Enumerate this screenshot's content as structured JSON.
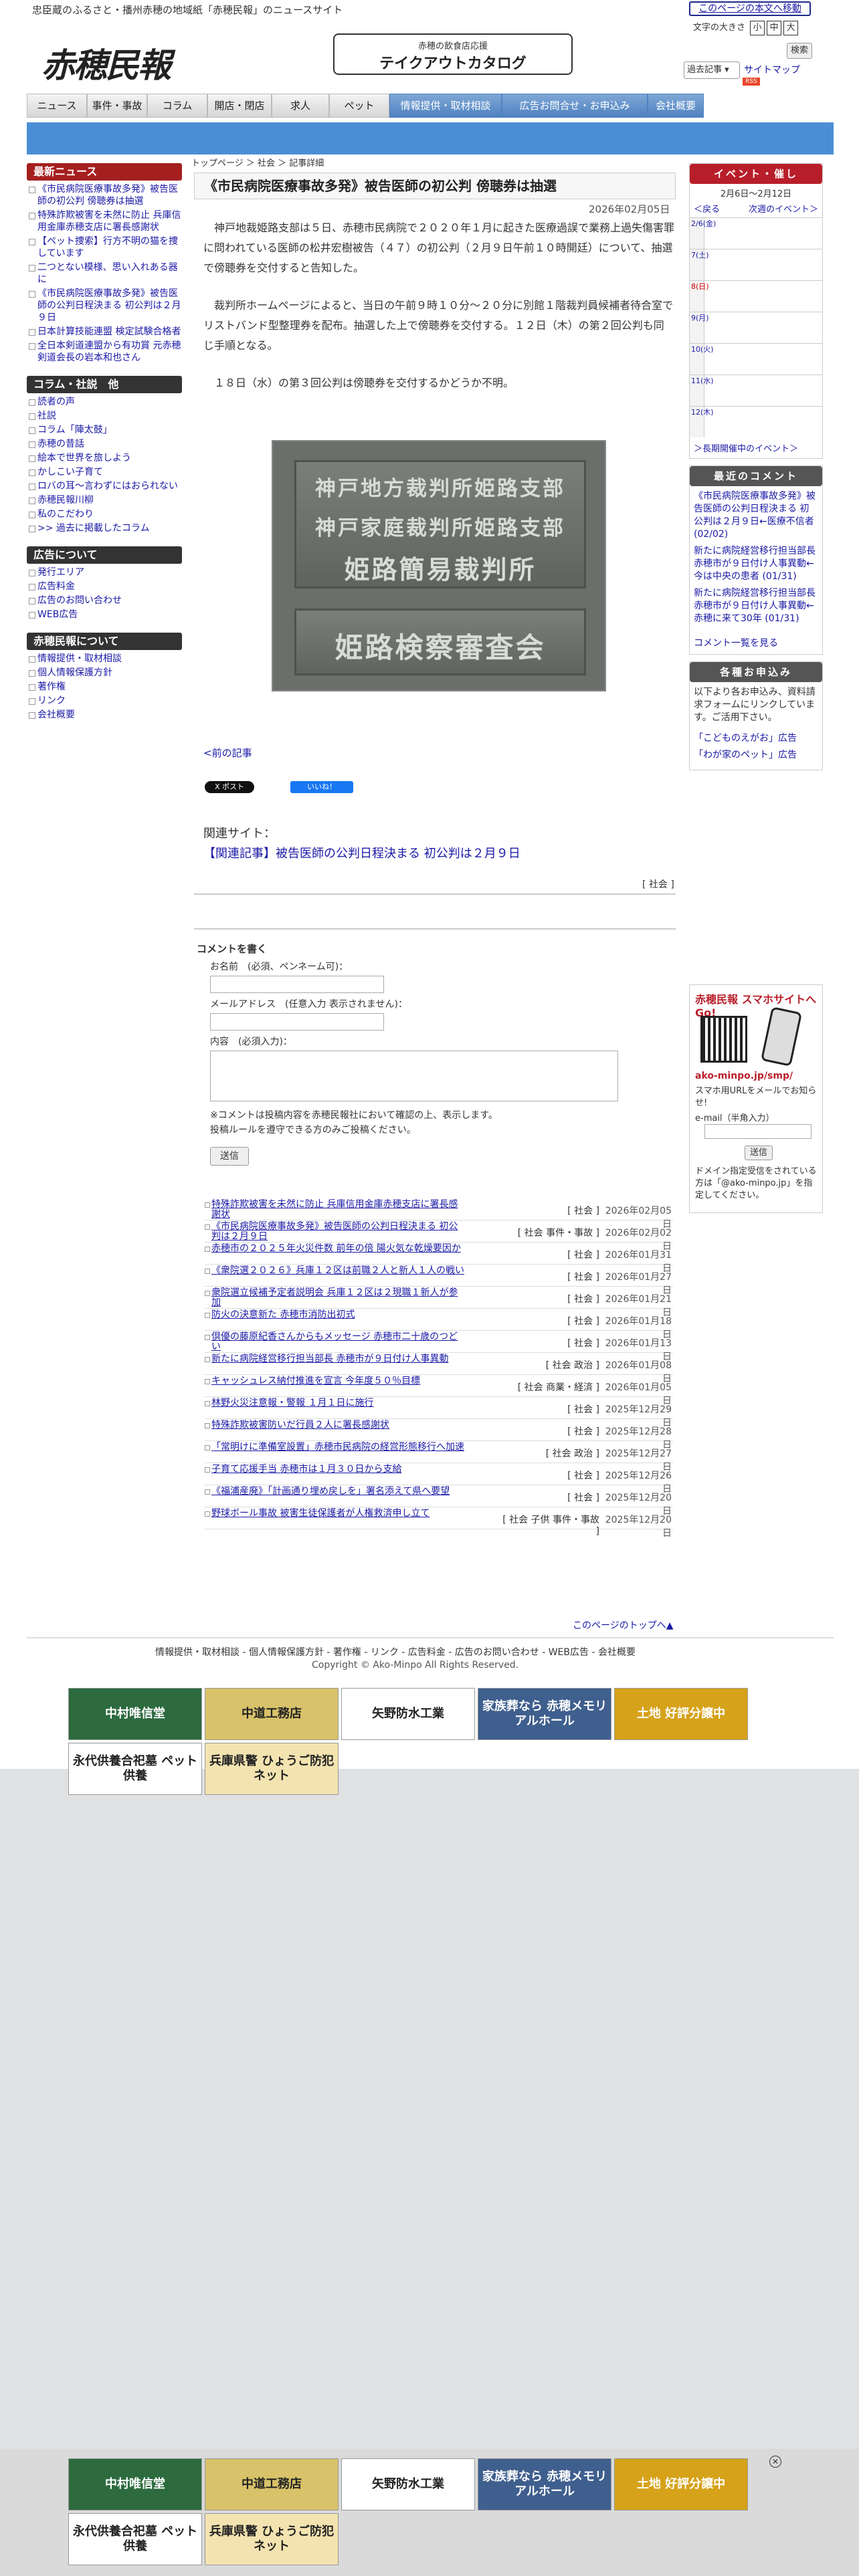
{
  "header": {
    "tagline": "忠臣蔵のふるさと・播州赤穂の地域紙「赤穂民報」のニュースサイト",
    "skip_link": "このページの本文へ移動",
    "font_size_label": "文字の大きさ",
    "font_small": "小",
    "font_medium": "中",
    "font_large": "大",
    "logo": "赤穂民報",
    "takeout_sub": "赤穂の飲食店応援",
    "takeout_main": "テイクアウトカタログ",
    "search_button": "検索",
    "past_select": "過去記事",
    "sitemap": "サイトマップ",
    "rss": "RSS"
  },
  "nav": [
    {
      "label": "ニュース",
      "style": "grey"
    },
    {
      "label": "事件・事故",
      "style": "grey"
    },
    {
      "label": "コラム",
      "style": "grey"
    },
    {
      "label": "開店・閉店",
      "style": "grey"
    },
    {
      "label": "求人",
      "style": "grey"
    },
    {
      "label": "ペット",
      "style": "grey"
    },
    {
      "label": "情報提供・取材相談",
      "style": "blue"
    },
    {
      "label": "広告お問合せ・お申込み",
      "style": "blue"
    },
    {
      "label": "会社概要",
      "style": "blue"
    }
  ],
  "left": {
    "latest_title": "最新ニュース",
    "latest": [
      "《市民病院医療事故多発》被告医師の初公判 傍聴券は抽選",
      "特殊詐欺被害を未然に防止 兵庫信用金庫赤穂支店に署長感謝状",
      "【ペット捜索】行方不明の猫を捜しています",
      "二つとない模様、思い入れある器に",
      "《市民病院医療事故多発》被告医師の公判日程決まる 初公判は２月９日",
      "日本計算技能連盟 検定試験合格者",
      "全日本剣道連盟から有功賞 元赤穂剣道会長の岩本和也さん"
    ],
    "column_title": "コラム・社説　他",
    "column": [
      "読者の声",
      "社説",
      "コラム「陣太鼓」",
      "赤穂の昔話",
      "絵本で世界を旅しよう",
      "かしこい子育て",
      "ロバの耳〜言わずにはおられない",
      "赤穂民報川柳",
      "私のこだわり",
      ">> 過去に掲載したコラム"
    ],
    "ad_title": "広告について",
    "ad": [
      "発行エリア",
      "広告料金",
      "広告のお問い合わせ",
      "WEB広告"
    ],
    "about_title": "赤穂民報について",
    "about": [
      "情報提供・取材相談",
      "個人情報保護方針",
      "著作権",
      "リンク",
      "会社概要"
    ]
  },
  "article": {
    "breadcrumb": "トップページ ＞ 社会 ＞ 記事詳細",
    "title": "《市民病院医療事故多発》被告医師の初公判 傍聴券は抽選",
    "date": "2026年02月05日",
    "p1": "神戸地裁姫路支部は５日、赤穂市民病院で２０２０年１月に起きた医療過誤で業務上過失傷害罪に問われている医師の松井宏樹被告（４７）の初公判（２月９日午前１０時開廷）について、抽選で傍聴券を交付すると告知した。",
    "p2": "裁判所ホームページによると、当日の午前９時１０分〜２０分に別館１階裁判員候補者待合室でリストバンド型整理券を配布。抽選した上で傍聴券を交付する。１２日（木）の第２回公判も同じ手順となる。",
    "p3": "１８日（水）の第３回公判は傍聴券を交付するかどうか不明。",
    "photo_sign1": "神戸地方裁判所姫路支部",
    "photo_sign2": "神戸家庭裁判所姫路支部",
    "photo_sign3": "姫路簡易裁判所",
    "photo_sign4": "姫路検察審査会",
    "prev": "<前の記事",
    "share_x": "X ポスト",
    "share_fb": "いいね！",
    "related_label": "関連サイト：",
    "related_link": "【関連記事】被告医師の公判日程決まる 初公判は２月９日",
    "category": "[ 社会 ]"
  },
  "comment_form": {
    "heading": "コメントを書く",
    "name_label": "お名前　(必須、ペンネーム可)：",
    "mail_label": "メールアドレス　(任意入力 表示されません)：",
    "body_label": "内容　(必須入力)：",
    "note1": "※コメントは投稿内容を赤穂民報社において確認の上、表示します。",
    "note2": "投稿ルールを遵守できる方のみご投稿ください。",
    "send": "送信"
  },
  "news_list": [
    {
      "title": "特殊詐欺被害を未然に防止 兵庫信用金庫赤穂支店に署長感謝状",
      "cat": "[ 社会 ]",
      "date": "2026年02月05日"
    },
    {
      "title": "《市民病院医療事故多発》被告医師の公判日程決まる 初公判は２月９日",
      "cat": "[ 社会 事件・事故 ]",
      "date": "2026年02月02日"
    },
    {
      "title": "赤穂市の２０２５年火災件数 前年の倍 陽火気な乾燥要因か",
      "cat": "[ 社会 ]",
      "date": "2026年01月31日"
    },
    {
      "title": "《衆院選２０２６》兵庫１２区は前職２人と新人１人の戦い",
      "cat": "[ 社会 ]",
      "date": "2026年01月27日"
    },
    {
      "title": "衆院選立候補予定者説明会 兵庫１２区は２現職１新人が参加",
      "cat": "[ 社会 ]",
      "date": "2026年01月21日"
    },
    {
      "title": "防火の決意新た 赤穂市消防出初式",
      "cat": "[ 社会 ]",
      "date": "2026年01月18日"
    },
    {
      "title": "倶優の藤原紀香さんからもメッセージ 赤穂市二十歳のつどい",
      "cat": "[ 社会 ]",
      "date": "2026年01月13日"
    },
    {
      "title": "新たに病院経営移行担当部長 赤穂市が９日付け人事異動",
      "cat": "[ 社会 政治 ]",
      "date": "2026年01月08日"
    },
    {
      "title": "キャッシュレス納付推進を宣言 今年度５０％目標",
      "cat": "[ 社会 商業・経済 ]",
      "date": "2026年01月05日"
    },
    {
      "title": "林野火災注意報・警報 １月１日に施行",
      "cat": "[ 社会 ]",
      "date": "2025年12月29日"
    },
    {
      "title": "特殊詐欺被害防いだ行員２人に署長感謝状",
      "cat": "[ 社会 ]",
      "date": "2025年12月28日"
    },
    {
      "title": "「常明けに準備室設置」赤穂市民病院の経営形態移行へ加速",
      "cat": "[ 社会 政治 ]",
      "date": "2025年12月27日"
    },
    {
      "title": "子育て応援手当 赤穂市は１月３０日から支給",
      "cat": "[ 社会 ]",
      "date": "2025年12月26日"
    },
    {
      "title": "《福浦産廃》「計画通り埋め戻しを」署名添えて県へ要望",
      "cat": "[ 社会 ]",
      "date": "2025年12月20日"
    },
    {
      "title": "野球ボール事故 被害生徒保護者が人権救済申し立て",
      "cat": "[ 社会 子供 事件・事故 ]",
      "date": "2025年12月20日"
    }
  ],
  "to_top": "このページのトップへ▲",
  "footer": {
    "links": "情報提供・取材相談 - 個人情報保護方針 - 著作権 - リンク - 広告料金 - 広告のお問い合わせ - WEB広告 - 会社概要",
    "copyright": "Copyright © Ako-Minpo All Rights Reserved."
  },
  "right": {
    "event_title": "イベント・催し",
    "event_range": "2月6日〜2月12日",
    "event_prev": "＜戻る",
    "event_next": "次週のイベント＞",
    "days": [
      {
        "label": "2/6(金)",
        "kind": "weekday"
      },
      {
        "label": "7(土)",
        "kind": "sat"
      },
      {
        "label": "8(日)",
        "kind": "sun"
      },
      {
        "label": "9(月)",
        "kind": "weekday"
      },
      {
        "label": "10(火)",
        "kind": "weekday"
      },
      {
        "label": "11(水)",
        "kind": "weekday"
      },
      {
        "label": "12(木)",
        "kind": "weekday"
      }
    ],
    "long_events": "＞長期開催中のイベント＞",
    "comments_title": "最近のコメント",
    "comments": [
      "《市民病院医療事故多発》被告医師の公判日程決まる 初公判は２月９日←医療不信者 (02/02)",
      "新たに病院経営移行担当部長 赤穂市が９日付け人事異動←今は中央の患者 (01/31)",
      "新たに病院経営移行担当部長 赤穂市が９日付け人事異動←赤穂に来て30年 (01/31)"
    ],
    "comments_more": "コメント一覧を見る",
    "notice_title": "各種お申込み",
    "notice_text": "以下より各お申込み、資料請求フォームにリンクしています。ご活用下さい。",
    "notice_links": [
      "「こどものえがお」広告",
      "「わが家のペット」広告"
    ],
    "smart_title": "赤穂民報 スマホサイトへGo!",
    "smart_url": "ako-minpo.jp/smp/",
    "smart_text": "スマホ用URLをメールでお知らせ!",
    "smart_email": "e-mail（半角入力）",
    "smart_send": "送信",
    "smart_note": "ドメイン指定受信をされている方は「@ako-minpo.jp」を指定してください。"
  },
  "ads": [
    "中村唯信堂",
    "中道工務店",
    "矢野防水工業",
    "家族葬なら 赤穂メモリアルホール",
    "土地 好評分譲中",
    "永代供養合祀墓 ペット供養",
    "兵庫県警 ひょうご防犯ネット"
  ],
  "colors": {
    "accent_red": "#b81e2a",
    "nav_blue": "#4a8fd6",
    "link": "#1a1aa6"
  }
}
